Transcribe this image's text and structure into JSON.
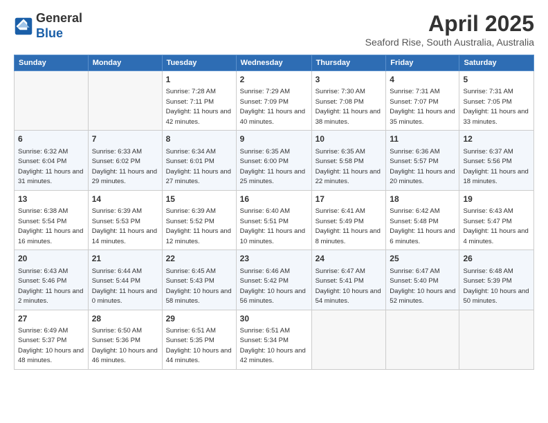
{
  "header": {
    "logo_general": "General",
    "logo_blue": "Blue",
    "month_title": "April 2025",
    "subtitle": "Seaford Rise, South Australia, Australia"
  },
  "columns": [
    "Sunday",
    "Monday",
    "Tuesday",
    "Wednesday",
    "Thursday",
    "Friday",
    "Saturday"
  ],
  "weeks": [
    [
      {
        "num": "",
        "info": "",
        "empty": true
      },
      {
        "num": "",
        "info": "",
        "empty": true
      },
      {
        "num": "1",
        "info": "Sunrise: 7:28 AM\nSunset: 7:11 PM\nDaylight: 11 hours and 42 minutes."
      },
      {
        "num": "2",
        "info": "Sunrise: 7:29 AM\nSunset: 7:09 PM\nDaylight: 11 hours and 40 minutes."
      },
      {
        "num": "3",
        "info": "Sunrise: 7:30 AM\nSunset: 7:08 PM\nDaylight: 11 hours and 38 minutes."
      },
      {
        "num": "4",
        "info": "Sunrise: 7:31 AM\nSunset: 7:07 PM\nDaylight: 11 hours and 35 minutes."
      },
      {
        "num": "5",
        "info": "Sunrise: 7:31 AM\nSunset: 7:05 PM\nDaylight: 11 hours and 33 minutes."
      }
    ],
    [
      {
        "num": "6",
        "info": "Sunrise: 6:32 AM\nSunset: 6:04 PM\nDaylight: 11 hours and 31 minutes."
      },
      {
        "num": "7",
        "info": "Sunrise: 6:33 AM\nSunset: 6:02 PM\nDaylight: 11 hours and 29 minutes."
      },
      {
        "num": "8",
        "info": "Sunrise: 6:34 AM\nSunset: 6:01 PM\nDaylight: 11 hours and 27 minutes."
      },
      {
        "num": "9",
        "info": "Sunrise: 6:35 AM\nSunset: 6:00 PM\nDaylight: 11 hours and 25 minutes."
      },
      {
        "num": "10",
        "info": "Sunrise: 6:35 AM\nSunset: 5:58 PM\nDaylight: 11 hours and 22 minutes."
      },
      {
        "num": "11",
        "info": "Sunrise: 6:36 AM\nSunset: 5:57 PM\nDaylight: 11 hours and 20 minutes."
      },
      {
        "num": "12",
        "info": "Sunrise: 6:37 AM\nSunset: 5:56 PM\nDaylight: 11 hours and 18 minutes."
      }
    ],
    [
      {
        "num": "13",
        "info": "Sunrise: 6:38 AM\nSunset: 5:54 PM\nDaylight: 11 hours and 16 minutes."
      },
      {
        "num": "14",
        "info": "Sunrise: 6:39 AM\nSunset: 5:53 PM\nDaylight: 11 hours and 14 minutes."
      },
      {
        "num": "15",
        "info": "Sunrise: 6:39 AM\nSunset: 5:52 PM\nDaylight: 11 hours and 12 minutes."
      },
      {
        "num": "16",
        "info": "Sunrise: 6:40 AM\nSunset: 5:51 PM\nDaylight: 11 hours and 10 minutes."
      },
      {
        "num": "17",
        "info": "Sunrise: 6:41 AM\nSunset: 5:49 PM\nDaylight: 11 hours and 8 minutes."
      },
      {
        "num": "18",
        "info": "Sunrise: 6:42 AM\nSunset: 5:48 PM\nDaylight: 11 hours and 6 minutes."
      },
      {
        "num": "19",
        "info": "Sunrise: 6:43 AM\nSunset: 5:47 PM\nDaylight: 11 hours and 4 minutes."
      }
    ],
    [
      {
        "num": "20",
        "info": "Sunrise: 6:43 AM\nSunset: 5:46 PM\nDaylight: 11 hours and 2 minutes."
      },
      {
        "num": "21",
        "info": "Sunrise: 6:44 AM\nSunset: 5:44 PM\nDaylight: 11 hours and 0 minutes."
      },
      {
        "num": "22",
        "info": "Sunrise: 6:45 AM\nSunset: 5:43 PM\nDaylight: 10 hours and 58 minutes."
      },
      {
        "num": "23",
        "info": "Sunrise: 6:46 AM\nSunset: 5:42 PM\nDaylight: 10 hours and 56 minutes."
      },
      {
        "num": "24",
        "info": "Sunrise: 6:47 AM\nSunset: 5:41 PM\nDaylight: 10 hours and 54 minutes."
      },
      {
        "num": "25",
        "info": "Sunrise: 6:47 AM\nSunset: 5:40 PM\nDaylight: 10 hours and 52 minutes."
      },
      {
        "num": "26",
        "info": "Sunrise: 6:48 AM\nSunset: 5:39 PM\nDaylight: 10 hours and 50 minutes."
      }
    ],
    [
      {
        "num": "27",
        "info": "Sunrise: 6:49 AM\nSunset: 5:37 PM\nDaylight: 10 hours and 48 minutes."
      },
      {
        "num": "28",
        "info": "Sunrise: 6:50 AM\nSunset: 5:36 PM\nDaylight: 10 hours and 46 minutes."
      },
      {
        "num": "29",
        "info": "Sunrise: 6:51 AM\nSunset: 5:35 PM\nDaylight: 10 hours and 44 minutes."
      },
      {
        "num": "30",
        "info": "Sunrise: 6:51 AM\nSunset: 5:34 PM\nDaylight: 10 hours and 42 minutes."
      },
      {
        "num": "",
        "info": "",
        "empty": true
      },
      {
        "num": "",
        "info": "",
        "empty": true
      },
      {
        "num": "",
        "info": "",
        "empty": true
      }
    ]
  ]
}
